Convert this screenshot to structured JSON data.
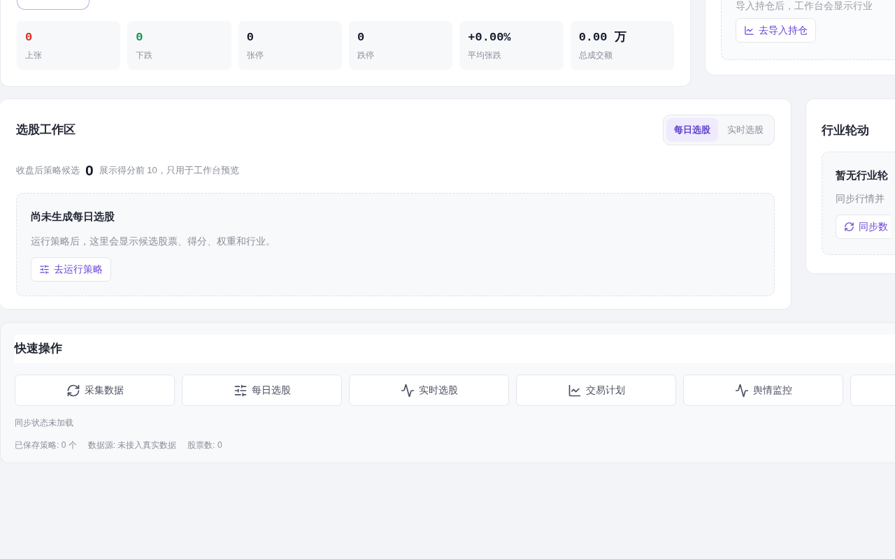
{
  "market_summary": {
    "stats": [
      {
        "value": "0",
        "label": "上张",
        "color": "#d92d20"
      },
      {
        "value": "0",
        "label": "下跌",
        "color": "#12924f"
      },
      {
        "value": "0",
        "label": "张停",
        "color": "#111827"
      },
      {
        "value": "0",
        "label": "跌停",
        "color": "#111827"
      },
      {
        "value": "+0.00%",
        "label": "平均张跌",
        "color": "#111827"
      },
      {
        "value": "0.00 万",
        "label": "总成交额",
        "color": "#111827"
      }
    ]
  },
  "holdings_card": {
    "hint": "导入持仓后，工作台会显示行业",
    "button": "去导入持仓"
  },
  "stock_picking": {
    "title": "选股工作区",
    "tabs": [
      {
        "label": "每日选股",
        "selected": true
      },
      {
        "label": "实时选股",
        "selected": false
      }
    ],
    "summary_label": "收盘后策略候选",
    "summary_count": "0",
    "summary_note": "展示得分前 10，只用于工作台预览",
    "empty": {
      "title": "尚未生成每日选股",
      "text": "运行策略后，这里会显示候选股票、得分、权重和行业。",
      "button": "去运行策略"
    }
  },
  "sector_rotation": {
    "title": "行业轮动",
    "empty": {
      "title": "暂无行业轮",
      "text": "同步行情并",
      "button": "同步数"
    }
  },
  "quick_actions": {
    "title": "快速操作",
    "buttons": [
      {
        "label": "采集数据",
        "kind": "refresh"
      },
      {
        "label": "每日选股",
        "kind": "sliders"
      },
      {
        "label": "实时选股",
        "kind": "pulse"
      },
      {
        "label": "交易计划",
        "kind": "chart"
      },
      {
        "label": "舆情监控",
        "kind": "pulse"
      },
      {
        "kind": "blank"
      }
    ],
    "sync_status": "同步状态未加载",
    "footer": [
      "已保存策略: 0 个",
      "数据源: 未接入真实数据",
      "股票数: 0"
    ]
  }
}
